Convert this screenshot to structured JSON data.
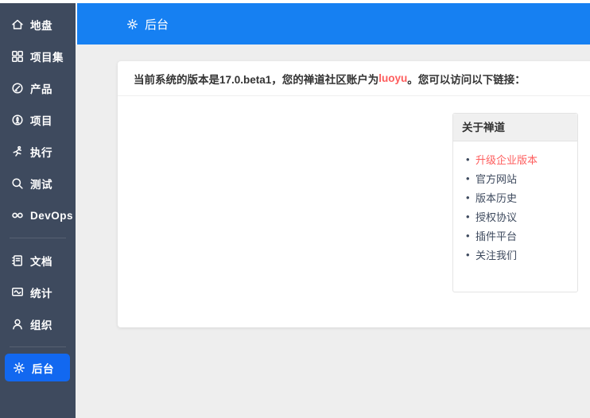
{
  "colors": {
    "sidebar_bg": "#3e4a5e",
    "topbar_blue": "#1680f2",
    "active_item_blue": "#1268f0",
    "content_bg": "#eeeeee",
    "danger_red": "#fe5d5d",
    "text_dark": "#333333"
  },
  "sidebar": {
    "items": [
      {
        "label": "地盘",
        "icon": "home-icon",
        "active": false
      },
      {
        "label": "项目集",
        "icon": "grid-icon",
        "active": false
      },
      {
        "label": "产品",
        "icon": "product-icon",
        "active": false
      },
      {
        "label": "项目",
        "icon": "project-icon",
        "active": false
      },
      {
        "label": "执行",
        "icon": "execution-runner-icon",
        "active": false
      },
      {
        "label": "测试",
        "icon": "test-magnifier-icon",
        "active": false
      },
      {
        "label": "DevOps",
        "icon": "devops-infinity-icon",
        "active": false
      },
      {
        "label": "文档",
        "icon": "document-icon",
        "active": false
      },
      {
        "label": "统计",
        "icon": "stats-monitor-icon",
        "active": false
      },
      {
        "label": "组织",
        "icon": "organization-person-icon",
        "active": false
      },
      {
        "label": "后台",
        "icon": "gear-icon",
        "active": true
      }
    ]
  },
  "topbar": {
    "title": "后台",
    "icon": "gear-icon"
  },
  "main": {
    "notice": {
      "prefix": "当前系统的版本是17.0.beta1，您的禅道社区账户为",
      "account": "luoyu",
      "suffix": "。您可以访问以下链接："
    },
    "about_panel": {
      "title": "关于禅道",
      "links": [
        {
          "label": "升级企业版本",
          "highlight": true
        },
        {
          "label": "官方网站",
          "highlight": false
        },
        {
          "label": "版本历史",
          "highlight": false
        },
        {
          "label": "授权协议",
          "highlight": false
        },
        {
          "label": "插件平台",
          "highlight": false
        },
        {
          "label": "关注我们",
          "highlight": false
        }
      ]
    }
  }
}
